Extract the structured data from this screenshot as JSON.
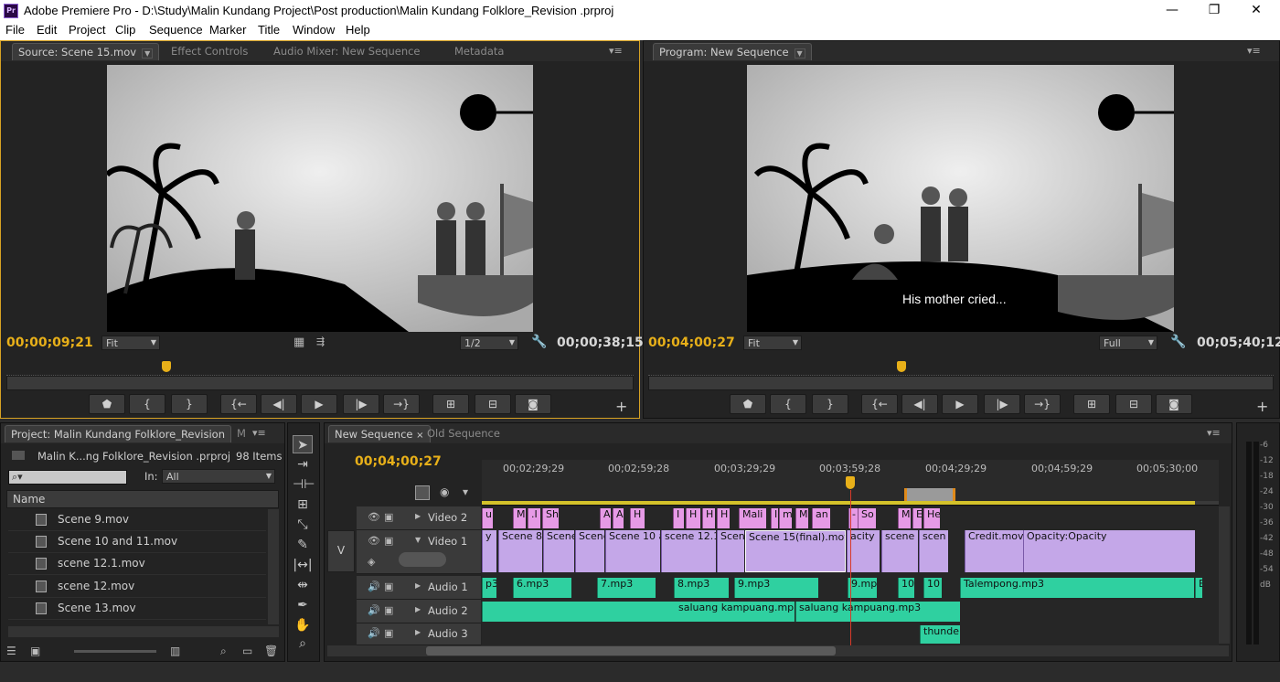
{
  "window": {
    "app_icon": "Pr",
    "title": "Adobe Premiere Pro - D:\\Study\\Malin Kundang Project\\Post production\\Malin Kundang Folklore_Revision .prproj",
    "minimize": "—",
    "maximize": "❐",
    "close": "✕"
  },
  "menu": [
    "File",
    "Edit",
    "Project",
    "Clip",
    "Sequence",
    "Marker",
    "Title",
    "Window",
    "Help"
  ],
  "source_panel": {
    "tabs": [
      "Source: Scene 15.mov",
      "Effect Controls",
      "Audio Mixer: New Sequence",
      "Metadata"
    ],
    "timecode": "00;00;09;21",
    "fit": "Fit",
    "resolution": "1/2",
    "duration": "00;00;38;15"
  },
  "program_panel": {
    "tabs": [
      "Program: New Sequence"
    ],
    "timecode": "00;04;00;27",
    "fit": "Fit",
    "resolution": "Full",
    "duration": "00;05;40;12",
    "subtitle": "His mother cried..."
  },
  "project_panel": {
    "tabs": [
      "Project: Malin Kundang Folklore_Revision",
      "M"
    ],
    "project_file": "Malin K...ng Folklore_Revision .prproj",
    "item_count": "98 Items",
    "in_label": "In:",
    "in_value": "All",
    "column_name": "Name",
    "items": [
      "Scene 9.mov",
      "Scene 10 and 11.mov",
      "scene 12.1.mov",
      "scene 12.mov",
      "Scene 13.mov"
    ]
  },
  "timeline": {
    "tabs": [
      "New Sequence",
      "Old Sequence"
    ],
    "timecode": "00;04;00;27",
    "ruler": [
      "00;02;29;29",
      "00;02;59;28",
      "00;03;29;29",
      "00;03;59;28",
      "00;04;29;29",
      "00;04;59;29",
      "00;05;30;00"
    ],
    "tracks": {
      "video2": "Video 2",
      "video1": "Video 1",
      "audio1": "Audio 1",
      "audio2": "Audio 2",
      "audio3": "Audio 3",
      "v_label": "V"
    },
    "v2_clips": [
      "u",
      "M",
      ".I",
      "Sh",
      "A",
      "A",
      "H",
      "I",
      "H",
      "H",
      "H",
      "Mali",
      "I",
      "m",
      "M",
      "an",
      "-",
      "So",
      "M",
      "E",
      "He"
    ],
    "v1_clips": [
      "y",
      "Scene 8.",
      "Scene",
      "Scene",
      "Scene 10 a",
      "scene 12.1",
      "Scen",
      "Scene 15(final).mov",
      "acity",
      "scene",
      "scen",
      "Credit.mov",
      "Opacity:Opacity"
    ],
    "a1_clips": [
      "p3",
      "6.mp3",
      "7.mp3",
      "8.mp3",
      "9.mp3",
      "9.mp",
      "10",
      "10",
      "Talempong.mp3",
      "E"
    ],
    "a2_clips": [
      "saluang kampuang.mp3",
      "saluang kampuang.mp3"
    ],
    "a3_clips": [
      "thunder"
    ]
  },
  "audio_meter": {
    "labels": [
      "-6",
      "-12",
      "-18",
      "-24",
      "-30",
      "-36",
      "-42",
      "-48",
      "-54",
      "dB"
    ]
  }
}
